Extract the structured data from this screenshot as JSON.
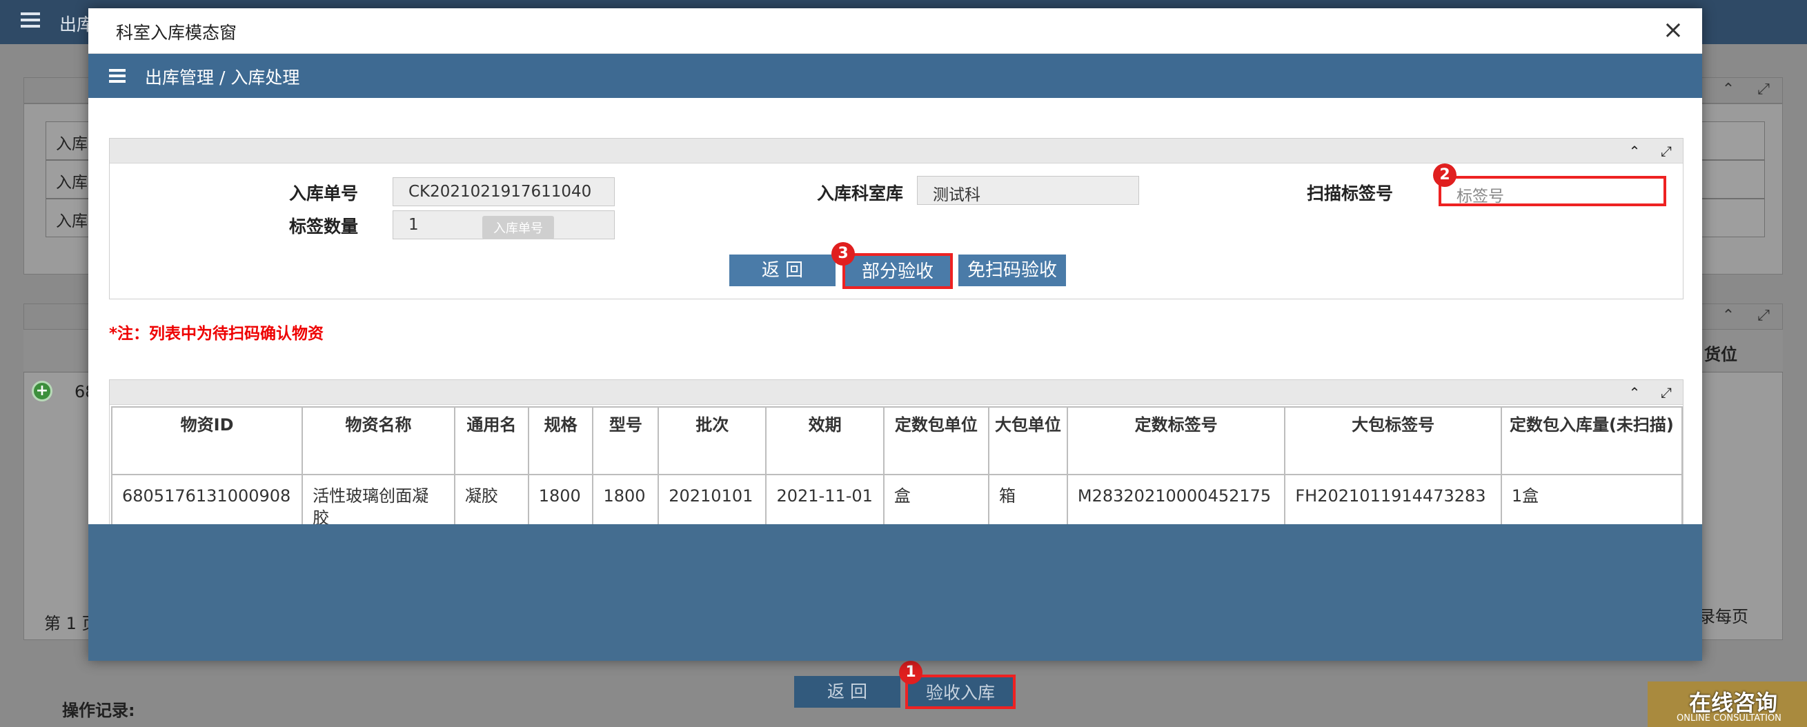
{
  "background": {
    "header_title": "出库",
    "rows": [
      "入库",
      "入库",
      "入库"
    ],
    "grid_first_cell": "68",
    "grid_right_header": "货位",
    "pager_left": "第 1 页",
    "pager_right": "录每页",
    "return_label": "返 回",
    "accept_label": "验收入库",
    "operation_log_label": "操作记录:"
  },
  "modal": {
    "title": "科室入库模态窗",
    "close_glyph": "×",
    "breadcrumb": "出库管理  /  入库处理",
    "panel_collapse_glyph": "⌃",
    "panel_expand_glyph": "⤢",
    "form": {
      "order_no_label": "入库单号",
      "order_no_value": "CK2021021917611040",
      "dept_label": "入库科室库",
      "dept_value": "测试科",
      "scan_label": "扫描标签号",
      "scan_placeholder": "标签号",
      "tag_count_label": "标签数量",
      "tag_count_value": "1",
      "tooltip": "入库单号"
    },
    "buttons": {
      "return_label": "返 回",
      "partial_accept_label": "部分验收",
      "no_scan_accept_label": "免扫码验收"
    },
    "note": "*注：列表中为待扫码确认物资",
    "table": {
      "columns": [
        "物资ID",
        "物资名称",
        "通用名",
        "规格",
        "型号",
        "批次",
        "效期",
        "定数包单位",
        "大包单位",
        "定数标签号",
        "大包标签号",
        "定数包入库量(未扫描)"
      ],
      "rows": [
        [
          "6805176131000908",
          "活性玻璃创面凝胶",
          "凝胶",
          "1800",
          "1800",
          "20210101",
          "2021-11-01",
          "盒",
          "箱",
          "M28320210000452175",
          "FH2021011914473283",
          "1盒"
        ]
      ]
    }
  },
  "badges": {
    "one": "1",
    "two": "2",
    "three": "3"
  },
  "float_ad": {
    "title": "在线咨询",
    "subtitle": "ONLINE CONSULTATION"
  }
}
